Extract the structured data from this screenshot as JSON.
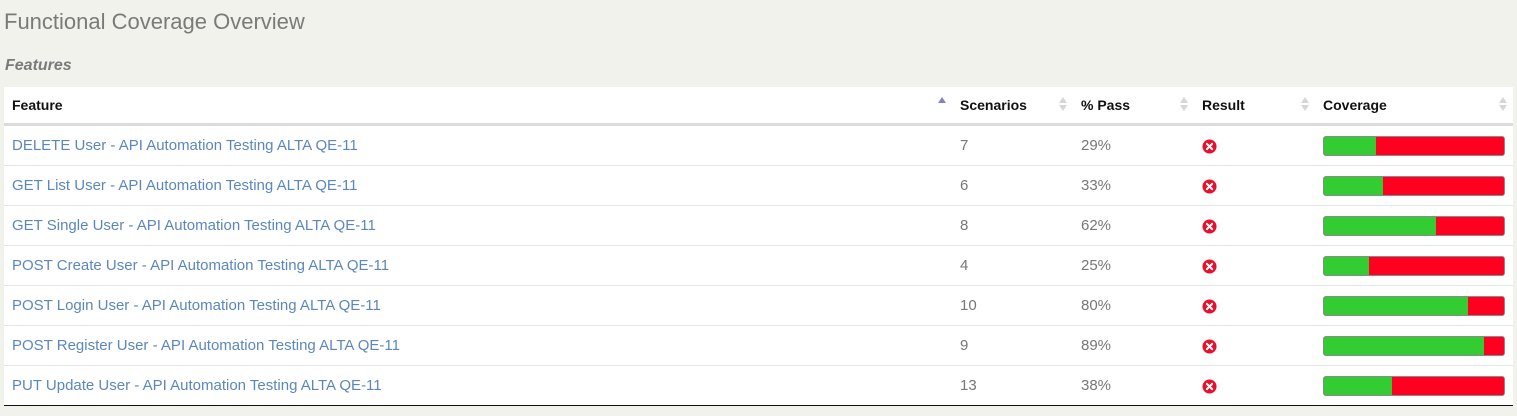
{
  "page": {
    "title": "Functional Coverage Overview",
    "section": "Features"
  },
  "table": {
    "columns": {
      "feature": "Feature",
      "scenarios": "Scenarios",
      "pass": "% Pass",
      "result": "Result",
      "coverage": "Coverage"
    },
    "sorted_by": "feature",
    "rows": [
      {
        "feature": "DELETE User - API Automation Testing ALTA QE-11",
        "scenarios": "7",
        "pass": "29%",
        "pass_fraction": 0.29,
        "result": "failed",
        "result_icon": "error-circle-icon"
      },
      {
        "feature": "GET List User - API Automation Testing ALTA QE-11",
        "scenarios": "6",
        "pass": "33%",
        "pass_fraction": 0.33,
        "result": "failed",
        "result_icon": "error-circle-icon"
      },
      {
        "feature": "GET Single User - API Automation Testing ALTA QE-11",
        "scenarios": "8",
        "pass": "62%",
        "pass_fraction": 0.62,
        "result": "failed",
        "result_icon": "error-circle-icon"
      },
      {
        "feature": "POST Create User - API Automation Testing ALTA QE-11",
        "scenarios": "4",
        "pass": "25%",
        "pass_fraction": 0.25,
        "result": "failed",
        "result_icon": "error-circle-icon"
      },
      {
        "feature": "POST Login User - API Automation Testing ALTA QE-11",
        "scenarios": "10",
        "pass": "80%",
        "pass_fraction": 0.8,
        "result": "failed",
        "result_icon": "error-circle-icon"
      },
      {
        "feature": "POST Register User - API Automation Testing ALTA QE-11",
        "scenarios": "9",
        "pass": "89%",
        "pass_fraction": 0.89,
        "result": "failed",
        "result_icon": "error-circle-icon"
      },
      {
        "feature": "PUT Update User - API Automation Testing ALTA QE-11",
        "scenarios": "13",
        "pass": "38%",
        "pass_fraction": 0.38,
        "result": "failed",
        "result_icon": "error-circle-icon"
      }
    ]
  },
  "colors": {
    "pass": "#33cc33",
    "fail": "#ff0020",
    "link": "#5b87bd",
    "background": "#f1f2eb"
  }
}
